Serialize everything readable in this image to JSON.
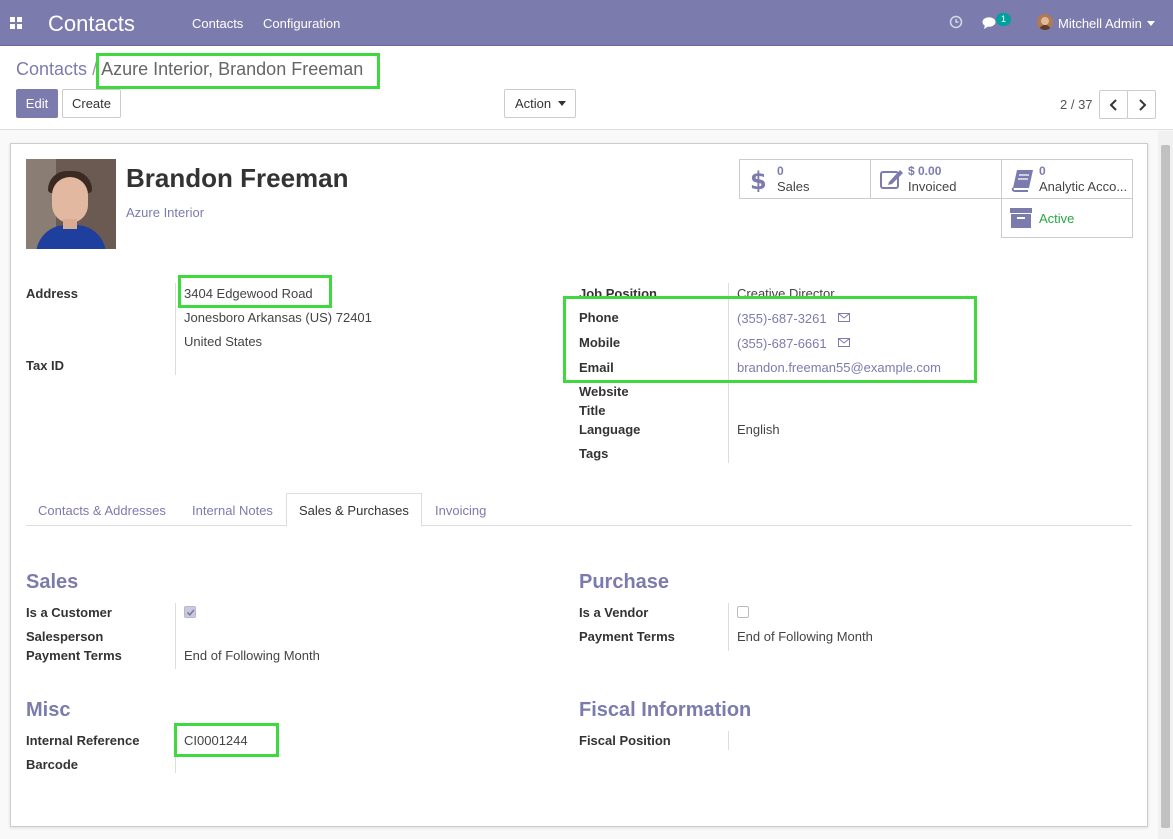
{
  "navbar": {
    "app_name": "Contacts",
    "menu": [
      "Contacts",
      "Configuration"
    ],
    "messages_count": "1",
    "user": "Mitchell Admin"
  },
  "breadcrumb": {
    "parent": "Contacts",
    "separator": "/",
    "current": "Azure Interior, Brandon Freeman"
  },
  "buttons": {
    "edit": "Edit",
    "create": "Create",
    "action": "Action"
  },
  "pager": "2 / 37",
  "contact": {
    "name": "Brandon Freeman",
    "company": "Azure Interior"
  },
  "stats": {
    "sales_value": "0",
    "sales_label": "Sales",
    "invoiced_value": "$ 0.00",
    "invoiced_label": "Invoiced",
    "analytic_value": "0",
    "analytic_label": "Analytic Acco...",
    "active_label": "Active"
  },
  "fields_left": {
    "address_label": "Address",
    "street": "3404 Edgewood Road",
    "city_line": "Jonesboro  Arkansas (US)  72401",
    "country": "United States",
    "tax_label": "Tax ID"
  },
  "fields_right": {
    "job_label": "Job Position",
    "job_value": "Creative Director",
    "phone_label": "Phone",
    "phone_value": "(355)-687-3261",
    "mobile_label": "Mobile",
    "mobile_value": "(355)-687-6661",
    "email_label": "Email",
    "email_value": "brandon.freeman55@example.com",
    "website_label": "Website",
    "title_label": "Title",
    "language_label": "Language",
    "language_value": "English",
    "tags_label": "Tags"
  },
  "tabs": [
    "Contacts & Addresses",
    "Internal Notes",
    "Sales & Purchases",
    "Invoicing"
  ],
  "sales": {
    "title": "Sales",
    "customer_label": "Is a Customer",
    "customer_checked": true,
    "salesperson_label": "Salesperson",
    "payment_label": "Payment Terms",
    "payment_value": "End of Following Month"
  },
  "purchase": {
    "title": "Purchase",
    "vendor_label": "Is a Vendor",
    "vendor_checked": false,
    "payment_label": "Payment Terms",
    "payment_value": "End of Following Month"
  },
  "misc": {
    "title": "Misc",
    "ref_label": "Internal Reference",
    "ref_value": "CI0001244",
    "barcode_label": "Barcode"
  },
  "fiscal": {
    "title": "Fiscal Information",
    "position_label": "Fiscal Position"
  },
  "colors": {
    "brand": "#7c7bad",
    "highlight": "#3fd83f",
    "active": "#28a745"
  }
}
